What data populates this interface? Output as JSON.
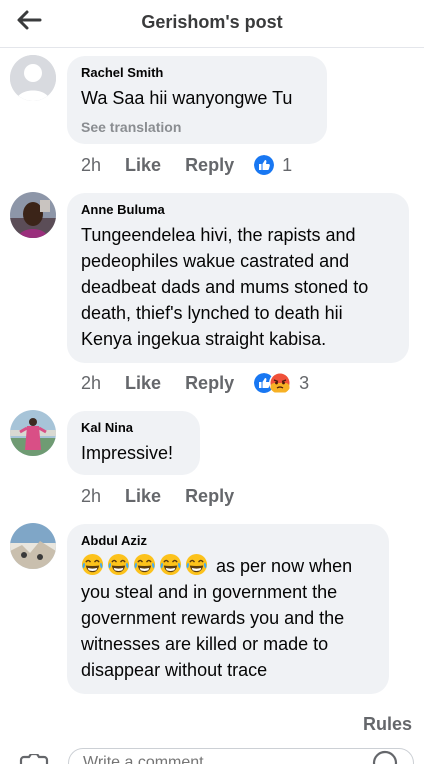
{
  "header": {
    "title": "Gerishom's post",
    "back_icon": "arrow-left-icon"
  },
  "comments": [
    {
      "author": "Rachel Smith",
      "text": "Wa Saa hii wanyongwe Tu",
      "see_translation": "See translation",
      "time": "2h",
      "like_label": "Like",
      "reply_label": "Reply",
      "reactions": [
        "like"
      ],
      "reaction_count": "1"
    },
    {
      "author": "Anne Buluma",
      "text": "Tungeendelea hivi, the rapists and pedeophiles  wakue castrated and deadbeat dads and mums stoned to death, thief's lynched to death hii Kenya ingekua straight kabisa.",
      "time": "2h",
      "like_label": "Like",
      "reply_label": "Reply",
      "reactions": [
        "like",
        "angry"
      ],
      "reaction_count": "3"
    },
    {
      "author": "Kal Nina",
      "text": "Impressive!",
      "time": "2h",
      "like_label": "Like",
      "reply_label": "Reply"
    },
    {
      "author": "Abdul Aziz",
      "emojis": "😂😂😂😂😂",
      "text": "as per now when you steal and in government the government rewards you and the witnesses are killed or made to disappear without trace"
    }
  ],
  "rules_label": "Rules",
  "composer": {
    "placeholder": "Write a comment...",
    "camera_icon": "camera-icon",
    "emoji_icon": "smiley-icon"
  },
  "colors": {
    "bubble": "#f0f2f5",
    "secondary_text": "#65676b",
    "like_blue": "#1877f2",
    "angry_orange": "#f0513a"
  }
}
